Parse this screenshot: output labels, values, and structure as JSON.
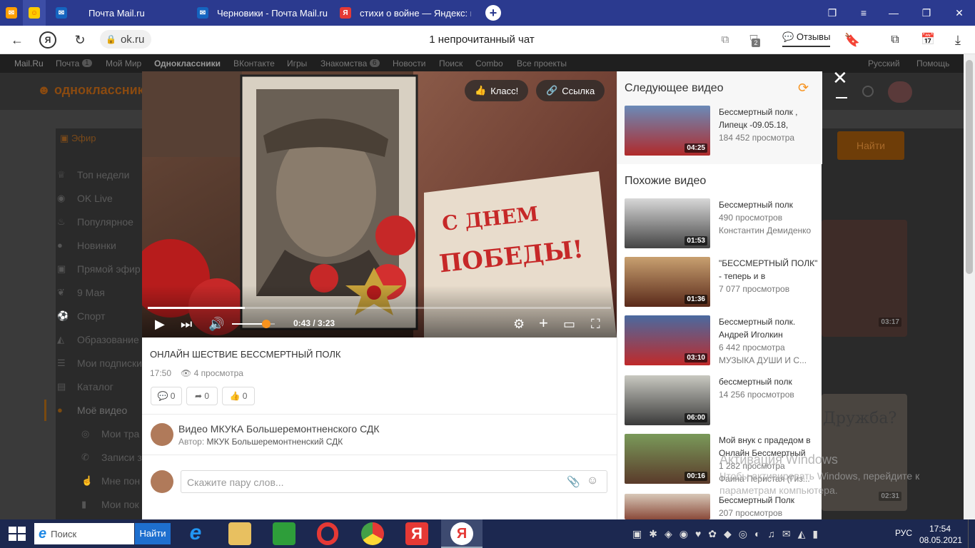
{
  "tabs": [
    {
      "title": "",
      "icon": "mail-icon",
      "color": "#ff9e00"
    },
    {
      "title": "",
      "icon": "ok-icon",
      "color": "#ffcc00"
    },
    {
      "title": "Почта Mail.ru",
      "icon": "mailru-icon",
      "color": "#1565c0"
    },
    {
      "title": "Черновики - Почта Mail.ru",
      "icon": "mailru-icon",
      "color": "#1565c0"
    },
    {
      "title": "стихи о войне — Яндекс: н",
      "icon": "yandex-icon",
      "color": "#e53935"
    }
  ],
  "address": {
    "url": "ok.ru",
    "page_title": "1 непрочитанный чат",
    "reviews_label": "Отзывы",
    "badge_count": "2"
  },
  "site_nav": {
    "items": [
      "Mail.Ru",
      "Почта",
      "Мой Мир",
      "Одноклассники",
      "ВКонтакте",
      "Игры",
      "Знакомства",
      "Новости",
      "Поиск",
      "Combo",
      "Все проекты"
    ],
    "mail_count": "1",
    "dating_count": "6",
    "lang": "Русский",
    "help": "Помощь"
  },
  "site_header": {
    "logo_text": "одноклассники",
    "find_button": "Найти",
    "efir": "Эфир"
  },
  "left_menu": [
    "Топ недели",
    "OK Live",
    "Популярное",
    "Новинки",
    "Прямой эфир",
    "9 Мая",
    "Спорт",
    "Образование",
    "Мои подписки",
    "Каталог",
    "Моё видео",
    "Мои тра",
    "Записи з",
    "Мне пон",
    "Мои пок"
  ],
  "player": {
    "class_label": "Класс!",
    "link_label": "Ссылка",
    "time": "0:43 / 3:23",
    "progress": 0.21,
    "volume": 0.8,
    "overlay_text_1": "С ДНЕМ",
    "overlay_text_2": "ПОБЕДЫ!"
  },
  "video": {
    "title": "ОНЛАЙН ШЕСТВИЕ БЕССМЕРТНЫЙ ПОЛК",
    "time": "17:50",
    "views": "4 просмотра",
    "comments": "0",
    "shares": "0",
    "likes": "0",
    "channel": "Видео МКУКА Большеремонтненского СДК",
    "author_label": "Автор:",
    "author": "МКУК Большеремонтненский СДК",
    "comment_placeholder": "Скажите пару слов..."
  },
  "next": {
    "heading": "Следующее видео",
    "title": "Бессмертный полк , Липецк -09.05.18,",
    "views": "184 452 просмотра",
    "duration": "04:25"
  },
  "similar": {
    "heading": "Похожие видео",
    "items": [
      {
        "title": "Бессмертный полк",
        "line2": "490 просмотров",
        "line3": "Константин Демиденко",
        "duration": "01:53"
      },
      {
        "title": "\"БЕССМЕРТНЫЙ ПОЛК\" - теперь и в",
        "line2": "7 077 просмотров",
        "line3": "",
        "duration": "01:36"
      },
      {
        "title": "Бессмертный полк. Андрей Иголкин",
        "line2": "6 442 просмотра",
        "line3": "МУЗЫКА ДУШИ И С...",
        "duration": "03:10"
      },
      {
        "title": "бессмертный полк",
        "line2": "14 256 просмотров",
        "line3": "",
        "duration": "06:00"
      },
      {
        "title": "Мой внук с прадедом в Онлайн Бессмертный",
        "line2": "1 282 просмотра",
        "line3": "Фаина Перистая (Гиз...",
        "duration": "00:16"
      },
      {
        "title": "Бессмертный Полк",
        "line2": "207 просмотров",
        "line3": "",
        "duration": ""
      }
    ]
  },
  "bg_cards": [
    {
      "duration": "03:17"
    },
    {
      "text": "Дружба?",
      "duration": "02:31"
    }
  ],
  "watermark": {
    "line1": "Активация Windows",
    "line2": "Чтобы активировать Windows, перейдите к параметрам компьютера."
  },
  "taskbar": {
    "search_placeholder": "Поиск",
    "search_button": "Найти",
    "lang": "РУС",
    "clock_time": "17:54",
    "clock_date": "08.05.2021"
  }
}
